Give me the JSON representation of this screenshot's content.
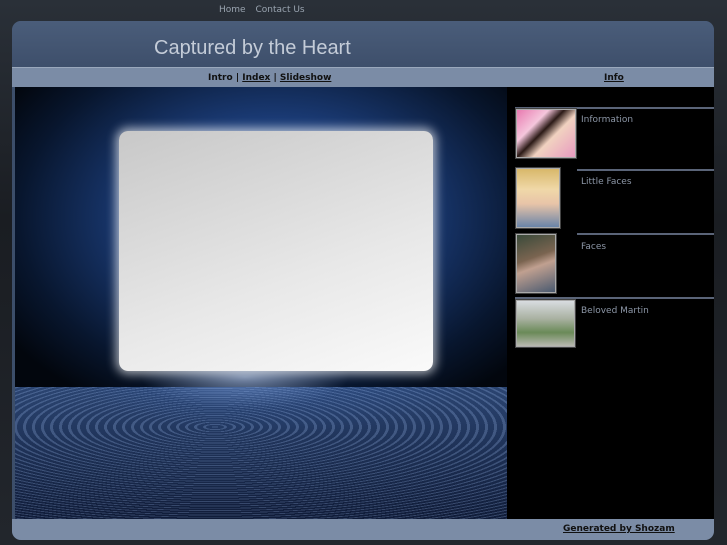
{
  "topnav": {
    "home": "Home",
    "contact": "Contact Us"
  },
  "header": {
    "title": "Captured by the Heart"
  },
  "nav": {
    "intro": "Intro",
    "sep1": " | ",
    "index": "Index",
    "sep2": " | ",
    "slideshow": "Slideshow",
    "info": "Info"
  },
  "galleries": [
    {
      "label": "Information"
    },
    {
      "label": "Little Faces"
    },
    {
      "label": "Faces"
    },
    {
      "label": "Beloved Martin"
    }
  ],
  "footer": {
    "generated": "Generated by Shozam"
  }
}
